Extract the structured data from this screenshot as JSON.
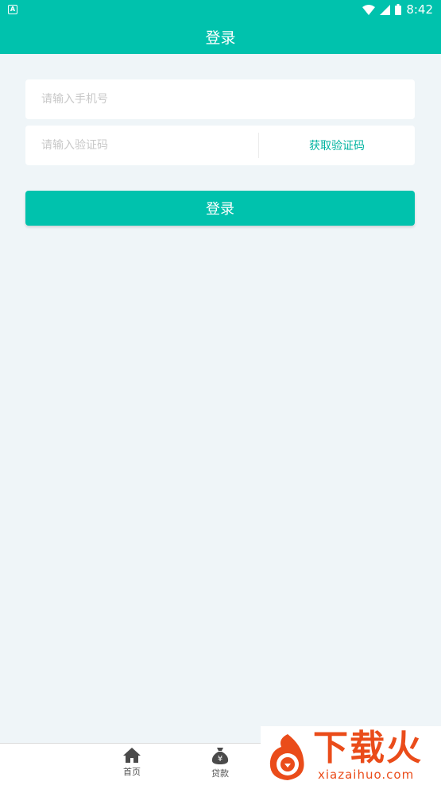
{
  "status_bar": {
    "time": "8:42"
  },
  "header": {
    "title": "登录"
  },
  "form": {
    "phone_placeholder": "请输入手机号",
    "code_placeholder": "请输入验证码",
    "get_code_label": "获取验证码",
    "submit_label": "登录"
  },
  "tabbar": {
    "items": [
      {
        "label": "首页",
        "icon": "home-icon"
      },
      {
        "label": "贷款",
        "icon": "money-bag-icon"
      }
    ]
  },
  "watermark": {
    "brand": "下载火",
    "url": "xiazaihuo.com"
  },
  "colors": {
    "primary": "#00c2ad",
    "accent_text": "#00b3a0",
    "background": "#eff5f8",
    "watermark": "#ea4c1a"
  }
}
